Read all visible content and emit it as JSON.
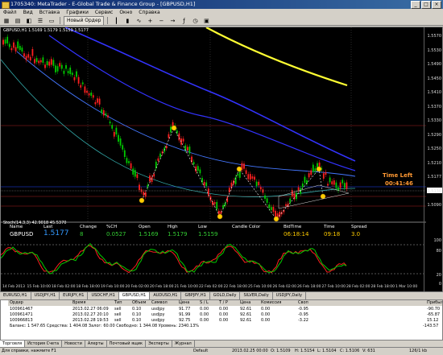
{
  "window": {
    "title": "1705340: MetaTrader - E-Global Trade & Finance Group - [GBPUSD,H1]"
  },
  "menu": [
    "Файл",
    "Вид",
    "Вставка",
    "Графики",
    "Сервис",
    "Окно",
    "Справка"
  ],
  "toolbar": {
    "new_order": "Новый Ордер"
  },
  "chart": {
    "title": "GBPUSD,H1  1.5169 1.5179 1.5159 1.5177",
    "lower_title": "Stoch(14,3,3) 42.9018 45.5370",
    "time_left_label": "Time Left",
    "time_left_value": "00:41:46",
    "price_labels": [
      "1.5570",
      "1.5530",
      "1.5490",
      "1.5450",
      "1.5410",
      "1.5370",
      "1.5330",
      "1.5290",
      "1.5250",
      "1.5210",
      "1.5177",
      "1.5130",
      "1.5090"
    ],
    "stoch_labels": [
      "100",
      "80",
      "20",
      "0"
    ],
    "time_labels": [
      "14 Feb 2013",
      "15 Feb 10:00",
      "18 Feb 02:00",
      "18 Feb 18:00",
      "19 Feb 10:00",
      "20 Feb 02:00",
      "20 Feb 18:00",
      "21 Feb 10:00",
      "22 Feb 02:00",
      "22 Feb 18:00",
      "25 Feb 10:00",
      "26 Feb 02:00",
      "26 Feb 18:00",
      "27 Feb 10:00",
      "28 Feb 02:00",
      "28 Feb 18:00",
      "1 Mar 10:00"
    ]
  },
  "info_panel": {
    "headers": [
      "Name",
      "Last",
      "Change",
      "%CH",
      "Open",
      "High",
      "Low",
      "Candle Color",
      "BidTime",
      "Time",
      "Spread"
    ],
    "values": [
      "GBPUSD",
      "1.5177",
      "8",
      "0.0527",
      "1.5169",
      "1.5179",
      "1.5159",
      "",
      "06:18:14",
      "09:18",
      "3.0"
    ]
  },
  "chart_tabs": [
    "EURUSD,H1",
    "USDJPY,H1",
    "EURJPY,H1",
    "USDCHF,H1",
    "GBPUSD,H1",
    "AUDUSD,H1",
    "GBPJPY,H1",
    "GOLD,Daily",
    "SILVER,Daily",
    "USDJPY,Daily"
  ],
  "terminal": {
    "columns": [
      "Ордер",
      "Время",
      "Тип",
      "Объем",
      "Символ",
      "Цена",
      "S / L",
      "T / P",
      "Цена",
      "Комиссия",
      "Своп",
      "Прибыль"
    ],
    "rows": [
      [
        "100961467",
        "2013.02.27 06:09",
        "sell",
        "0.10",
        "usdjpy",
        "91.77",
        "0.00",
        "0.00",
        "92.61",
        "0.00",
        "-0.95",
        "-90.70"
      ],
      [
        "100961471",
        "2013.02.27 20:10",
        "sell",
        "0.10",
        "usdjpy",
        "91.99",
        "0.00",
        "0.00",
        "92.61",
        "0.00",
        "-0.95",
        "-65.87"
      ],
      [
        "100966813",
        "2013.02.28 19:53",
        "sell",
        "0.10",
        "usdjpy",
        "92.75",
        "0.00",
        "0.00",
        "92.61",
        "0.00",
        "-3.22",
        "15.12"
      ]
    ],
    "summary": "Баланс: 1 547.65 Средства: 1 404.08 Залог: 60.00 Свободно: 1 344.08 Уровень: 2340.13%",
    "summary_profit": "-143.57",
    "tabs": [
      "Торговля",
      "История Счета",
      "Новости",
      "Алерты",
      "Почтовый ящик",
      "Эксперты",
      "Журнал"
    ]
  },
  "status": {
    "help": "Для справки, нажмите F1",
    "profile": "Default",
    "datetime": "2013.02.25 00:00",
    "o": "O: 1.5109",
    "h": "H: 1.5154",
    "l": "L: 1.5104",
    "c": "C: 1.5106",
    "v": "V: 631",
    "traffic": "126/1 kb"
  },
  "colors": {
    "background": "#000000",
    "bull": "#00cc00",
    "bear": "#ff2020",
    "ma_yellow": "#ffff33",
    "ma_blue": "#3333ff",
    "stoch_main": "#00cc00",
    "stoch_signal": "#ff2020"
  }
}
